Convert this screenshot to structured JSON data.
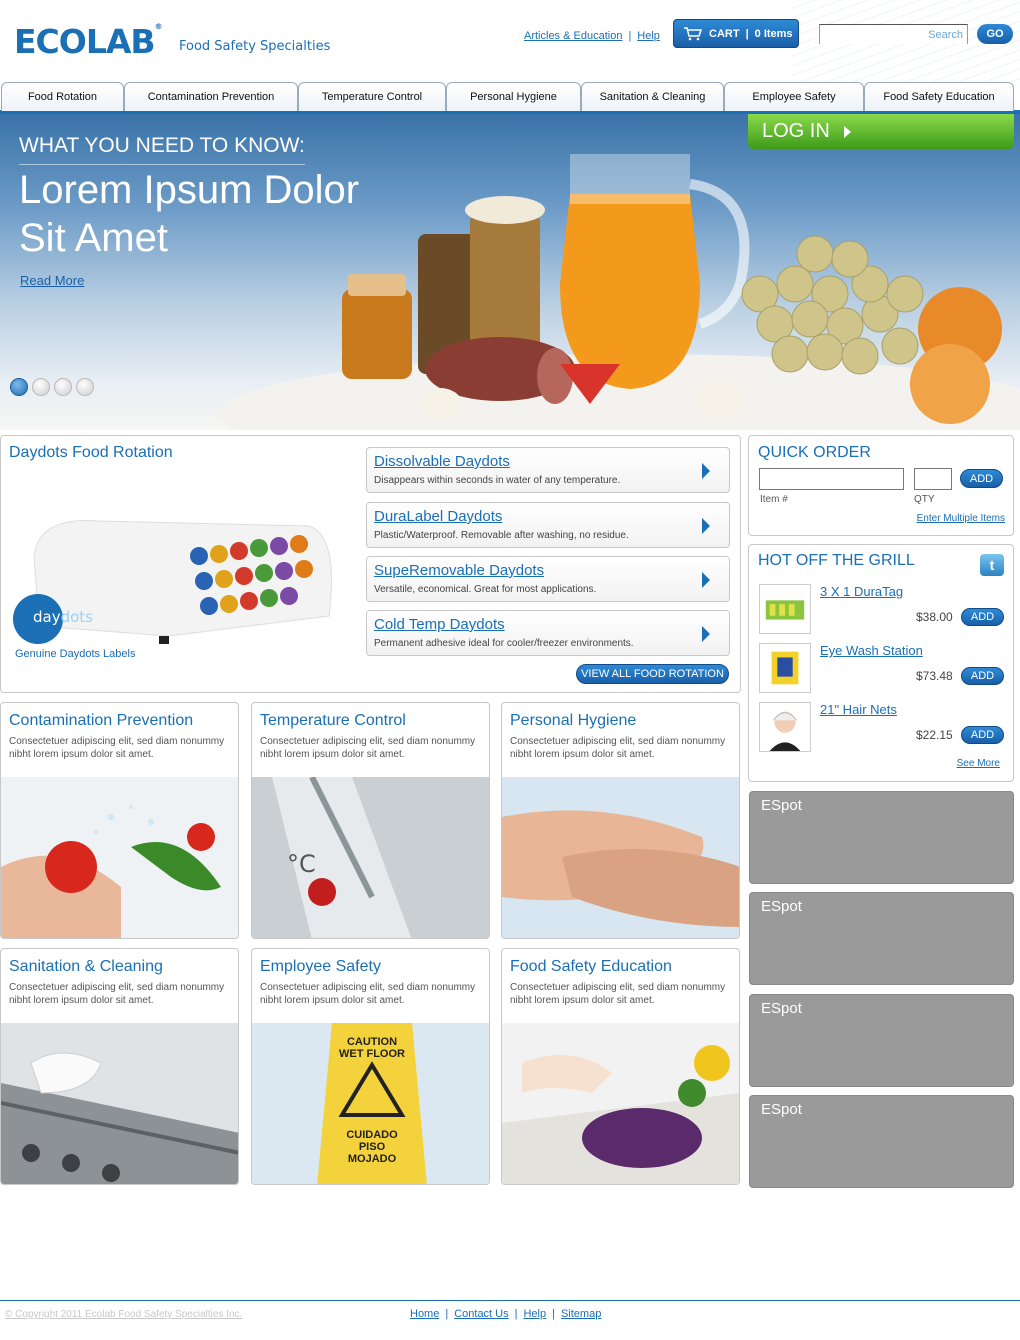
{
  "brand": {
    "logo": "ECOLAB",
    "tm": "®",
    "subtitle": "Food Safety Specialties"
  },
  "toplinks": {
    "articles": "Articles & Education",
    "help": "Help"
  },
  "cart": {
    "label": "CART",
    "items": "0 Items",
    "icon": "cart-icon"
  },
  "search": {
    "placeholder": "Search",
    "go": "GO"
  },
  "nav": {
    "tabs": [
      "Food Rotation",
      "Contamination Prevention",
      "Temperature Control",
      "Personal Hygiene",
      "Sanitation & Cleaning",
      "Employee Safety",
      "Food Safety Education"
    ]
  },
  "hero": {
    "kicker": "WHAT YOU NEED TO KNOW:",
    "title": "Lorem Ipsum Dolor Sit Amet",
    "read_more": "Read More",
    "slides": 4,
    "active_slide": 1
  },
  "login": {
    "label": "LOG IN"
  },
  "daydots": {
    "title": "Daydots Food Rotation",
    "badge_prefix": "day",
    "badge_suffix": "dots",
    "caption": "Genuine Daydots Labels",
    "products": [
      {
        "name": "Dissolvable Daydots",
        "desc": "Disappears within seconds in water of any temperature."
      },
      {
        "name": "DuraLabel Daydots",
        "desc": "Plastic/Waterproof. Removable after washing, no residue."
      },
      {
        "name": "SupeRemovable Daydots",
        "desc": "Versatile, economical. Great for most applications."
      },
      {
        "name": "Cold Temp Daydots",
        "desc": "Permanent adhesive ideal for cooler/freezer environments."
      }
    ],
    "view_all": "VIEW ALL FOOD ROTATION"
  },
  "quick_order": {
    "title": "QUICK ORDER",
    "add": "ADD",
    "item_label": "Item #",
    "qty_label": "QTY",
    "multiple": "Enter Multiple Items"
  },
  "grill": {
    "title": "HOT OFF THE GRILL",
    "twitter_icon": "t",
    "items": [
      {
        "name": "3 X 1 DuraTag",
        "price": "$38.00",
        "add": "ADD"
      },
      {
        "name": "Eye Wash Station",
        "price": "$73.48",
        "add": "ADD"
      },
      {
        "name": "21\" Hair Nets",
        "price": "$22.15",
        "add": "ADD"
      }
    ],
    "see_more": "See More"
  },
  "cards": [
    {
      "title": "Contamination Prevention",
      "desc": "Consectetuer adipiscing elit, sed diam nonummy nibht lorem ipsum dolor sit amet."
    },
    {
      "title": "Temperature Control",
      "desc": "Consectetuer adipiscing elit, sed diam nonummy nibht lorem ipsum dolor sit amet."
    },
    {
      "title": "Personal Hygiene",
      "desc": "Consectetuer adipiscing elit, sed diam nonummy nibht lorem ipsum dolor sit amet."
    },
    {
      "title": "Sanitation & Cleaning",
      "desc": "Consectetuer adipiscing elit, sed diam nonummy nibht lorem ipsum dolor sit amet."
    },
    {
      "title": "Employee Safety",
      "desc": "Consectetuer adipiscing elit, sed diam nonummy nibht lorem ipsum dolor sit amet."
    },
    {
      "title": "Food Safety Education",
      "desc": "Consectetuer adipiscing elit, sed diam nonummy nibht lorem ipsum dolor sit amet."
    }
  ],
  "sign": {
    "line1": "CAUTION",
    "line2": "WET FLOOR",
    "line3": "CUIDADO",
    "line4": "PISO",
    "line5": "MOJADO"
  },
  "espots": [
    "ESpot",
    "ESpot",
    "ESpot",
    "ESpot"
  ],
  "footer": {
    "copyright": "© Copyright 2011 Ecolab Food Safety Specialties Inc.",
    "links": [
      "Home",
      "Contact Us",
      "Help",
      "Sitemap"
    ]
  }
}
